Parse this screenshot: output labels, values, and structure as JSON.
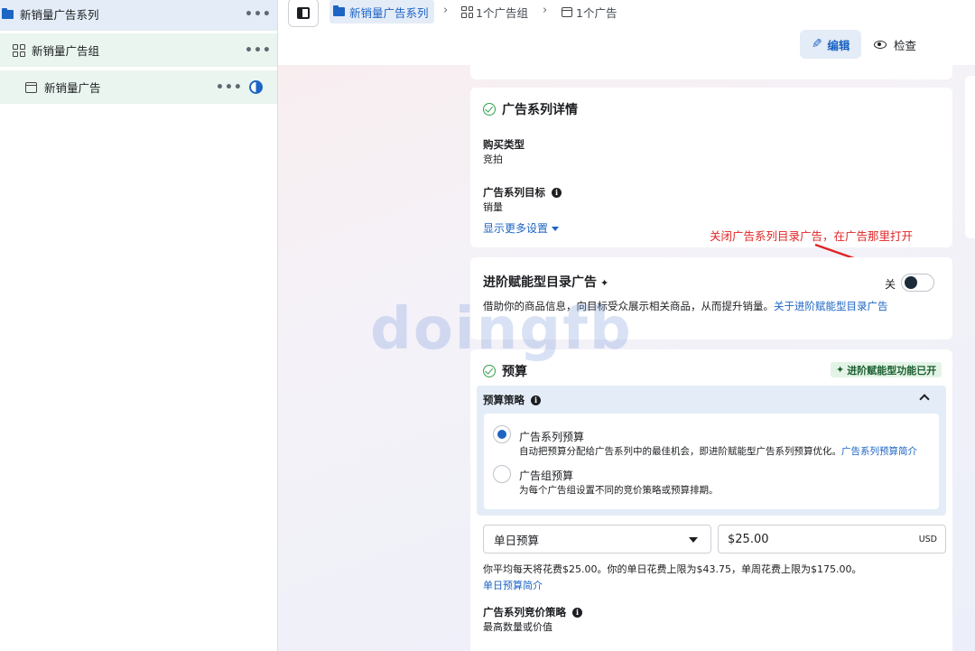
{
  "sidebar": {
    "campaign": {
      "label": "新销量广告系列",
      "more": "•••"
    },
    "adset": {
      "label": "新销量广告组",
      "more": "•••"
    },
    "ad": {
      "label": "新销量广告",
      "more": "•••"
    }
  },
  "breadcrumb": {
    "campaign": "新销量广告系列",
    "adset": "1个广告组",
    "ad": "1个广告",
    "separator": "›"
  },
  "toolbar": {
    "edit_label": "编辑",
    "review_label": "检查"
  },
  "details_card": {
    "title": "广告系列详情",
    "buy_type_label": "购买类型",
    "buy_type_value": "竞拍",
    "objective_label": "广告系列目标",
    "objective_value": "销量",
    "show_more": "显示更多设置"
  },
  "annotation": {
    "text": "关闭广告系列目录广告，在广告那里打开",
    "color": "#e02424"
  },
  "advantage_card": {
    "title": "进阶赋能型目录广告",
    "switch_label": "关",
    "switch_on": false,
    "description": "借助你的商品信息，向目标受众展示相关商品，从而提升销量。",
    "link": "关于进阶赋能型目录广告"
  },
  "budget_card": {
    "title": "预算",
    "badge": "进阶赋能型功能已开",
    "strategy_label": "预算策略",
    "options": [
      {
        "title": "广告系列预算",
        "desc": "自动把预算分配给广告系列中的最佳机会，即进阶赋能型广告系列预算优化。",
        "link": "广告系列预算简介",
        "checked": true
      },
      {
        "title": "广告组预算",
        "desc": "为每个广告组设置不同的竞价策略或预算排期。",
        "link": "",
        "checked": false
      }
    ],
    "budget_type": "单日预算",
    "amount": "$25.00",
    "currency": "USD",
    "note": "你平均每天将花费$25.00。你的单日花费上限为$43.75，单周花费上限为$175.00。",
    "note_link": "单日预算简介",
    "bid_label": "广告系列竞价策略",
    "bid_value": "最高数量或价值"
  },
  "watermark": "doingfb",
  "colors": {
    "accent": "#1d64c4",
    "success": "#31a24c",
    "annotation": "#e02424"
  }
}
